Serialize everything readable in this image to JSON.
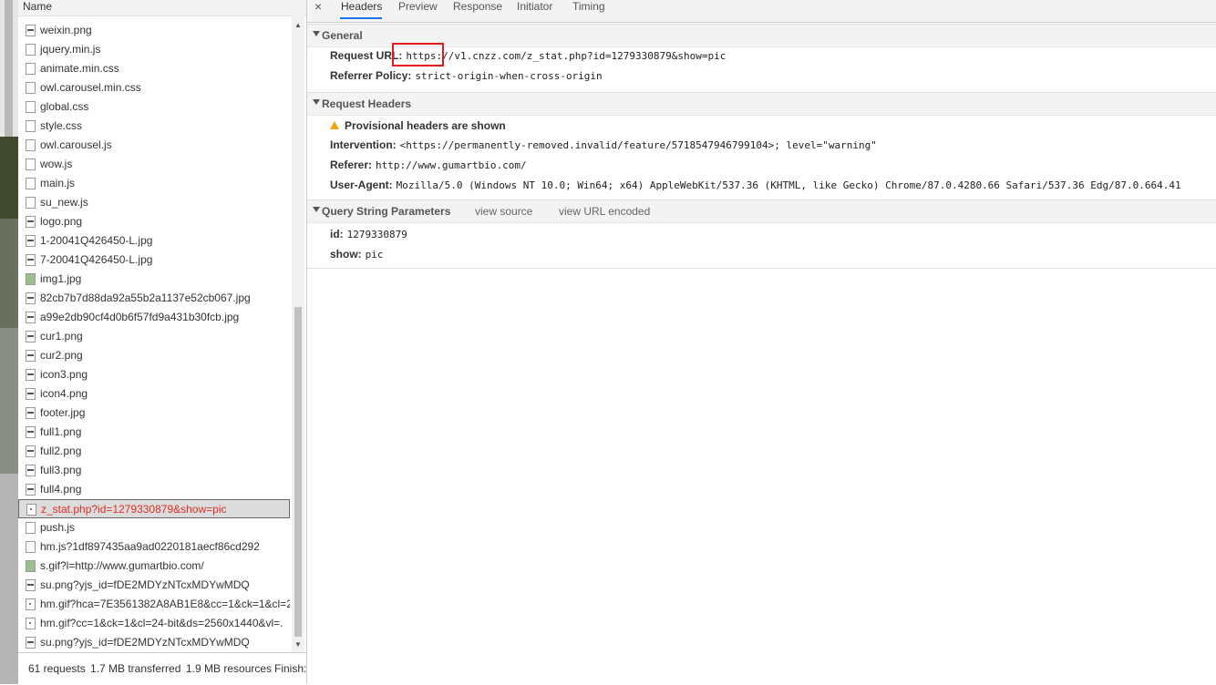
{
  "request_list": {
    "column_header": "Name",
    "rows": [
      {
        "name": "weixin.png",
        "icon": "image-file-icon"
      },
      {
        "name": "jquery.min.js",
        "icon": "script-file-icon"
      },
      {
        "name": "animate.min.css",
        "icon": "stylesheet-file-icon"
      },
      {
        "name": "owl.carousel.min.css",
        "icon": "stylesheet-file-icon"
      },
      {
        "name": "global.css",
        "icon": "stylesheet-file-icon"
      },
      {
        "name": "style.css",
        "icon": "stylesheet-file-icon"
      },
      {
        "name": "owl.carousel.js",
        "icon": "script-file-icon"
      },
      {
        "name": "wow.js",
        "icon": "script-file-icon"
      },
      {
        "name": "main.js",
        "icon": "script-file-icon"
      },
      {
        "name": "su_new.js",
        "icon": "script-file-icon"
      },
      {
        "name": "logo.png",
        "icon": "image-file-icon"
      },
      {
        "name": "1-20041Q426450-L.jpg",
        "icon": "image-file-icon"
      },
      {
        "name": "7-20041Q426450-L.jpg",
        "icon": "image-file-icon"
      },
      {
        "name": "img1.jpg",
        "icon": "image-thumbnail-icon"
      },
      {
        "name": "82cb7b7d88da92a55b2a1137e52cb067.jpg",
        "icon": "image-file-icon"
      },
      {
        "name": "a99e2db90cf4d0b6f57fd9a431b30fcb.jpg",
        "icon": "image-file-icon"
      },
      {
        "name": "cur1.png",
        "icon": "image-file-icon"
      },
      {
        "name": "cur2.png",
        "icon": "image-file-icon"
      },
      {
        "name": "icon3.png",
        "icon": "image-file-icon"
      },
      {
        "name": "icon4.png",
        "icon": "image-file-icon"
      },
      {
        "name": "footer.jpg",
        "icon": "image-file-icon"
      },
      {
        "name": "full1.png",
        "icon": "image-file-icon"
      },
      {
        "name": "full2.png",
        "icon": "image-file-icon"
      },
      {
        "name": "full3.png",
        "icon": "image-file-icon"
      },
      {
        "name": "full4.png",
        "icon": "image-file-icon"
      },
      {
        "name": "z_stat.php?id=1279330879&show=pic",
        "icon": "document-file-icon",
        "selected": true
      },
      {
        "name": "push.js",
        "icon": "script-file-icon"
      },
      {
        "name": "hm.js?1df897435aa9ad0220181aecf86cd292",
        "icon": "script-file-icon"
      },
      {
        "name": "s.gif?l=http://www.gumartbio.com/",
        "icon": "image-thumbnail-icon"
      },
      {
        "name": "su.png?yjs_id=fDE2MDYzNTcxMDYwMDQ",
        "icon": "image-file-icon"
      },
      {
        "name": "hm.gif?hca=7E3561382A8AB1E8&cc=1&ck=1&cl=2",
        "icon": "document-file-icon"
      },
      {
        "name": "hm.gif?cc=1&ck=1&cl=24-bit&ds=2560x1440&vl=.",
        "icon": "document-file-icon"
      },
      {
        "name": "su.png?yjs_id=fDE2MDYzNTcxMDYwMDQ",
        "icon": "image-file-icon"
      }
    ]
  },
  "status_bar": {
    "requests": "61 requests",
    "transferred": "1.7 MB transferred",
    "resources": "1.9 MB resources",
    "finish": "Finish:"
  },
  "tabs": {
    "close_symbol": "×",
    "items": [
      "Headers",
      "Preview",
      "Response",
      "Initiator",
      "Timing"
    ],
    "active": "Headers",
    "accent_color": "#1a73e8"
  },
  "general": {
    "title": "General",
    "request_url_label": "Request URL:",
    "request_url_value": "https://v1.cnzz.com/z_stat.php?id=1279330879&show=pic",
    "referrer_policy_label": "Referrer Policy:",
    "referrer_policy_value": "strict-origin-when-cross-origin"
  },
  "request_headers": {
    "title": "Request Headers",
    "warning": "Provisional headers are shown",
    "intervention_label": "Intervention:",
    "intervention_value": "<https://permanently-removed.invalid/feature/5718547946799104>; level=\"warning\"",
    "referer_label": "Referer:",
    "referer_value": "http://www.gumartbio.com/",
    "user_agent_label": "User-Agent:",
    "user_agent_value": "Mozilla/5.0 (Windows NT 10.0; Win64; x64) AppleWebKit/537.36 (KHTML, like Gecko) Chrome/87.0.4280.66 Safari/537.36 Edg/87.0.664.41"
  },
  "query_params": {
    "title": "Query String Parameters",
    "view_source": "view source",
    "view_url_encoded": "view URL encoded",
    "id_label": "id:",
    "id_value": "1279330879",
    "show_label": "show:",
    "show_value": "pic"
  },
  "highlight_color": "#e01b24",
  "warning_color": "#f0a30a"
}
